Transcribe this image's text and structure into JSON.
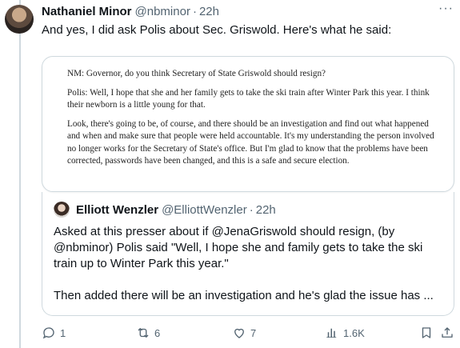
{
  "tweet": {
    "author_name": "Nathaniel Minor",
    "author_handle": "@nbminor",
    "separator": "·",
    "time": "22h",
    "more": "···",
    "text": "And yes, I did ask Polis about Sec. Griswold. Here's what he said:"
  },
  "document": {
    "paragraphs": [
      "NM: Governor, do you think Secretary of State Griswold should resign?",
      "Polis: Well, I hope that she and her family gets to take the ski train after Winter Park this year. I think their newborn is a little young for that.",
      "Look, there's going to be, of course, and there should be an investigation and find out what happened and when and make sure that people were held accountable. It's my understanding the person involved no longer works for the Secretary of State's office. But I'm glad to know that the problems have been corrected, passwords have been changed, and this is a safe and secure election."
    ]
  },
  "quote": {
    "author_name": "Elliott Wenzler",
    "author_handle": "@ElliottWenzler",
    "separator": "·",
    "time": "22h",
    "text_1": "Asked at this presser about if @JenaGriswold should resign, (by @nbminor) Polis said \"Well, I hope she and family gets to take the ski train up to Winter Park this year.\"",
    "text_2": "Then added there will be an investigation and he's glad the issue has ..."
  },
  "actions": {
    "replies": "1",
    "reposts": "6",
    "likes": "7",
    "views": "1.6K",
    "icons": [
      "reply-icon",
      "repost-icon",
      "like-icon",
      "views-icon",
      "bookmark-icon",
      "share-icon"
    ]
  }
}
